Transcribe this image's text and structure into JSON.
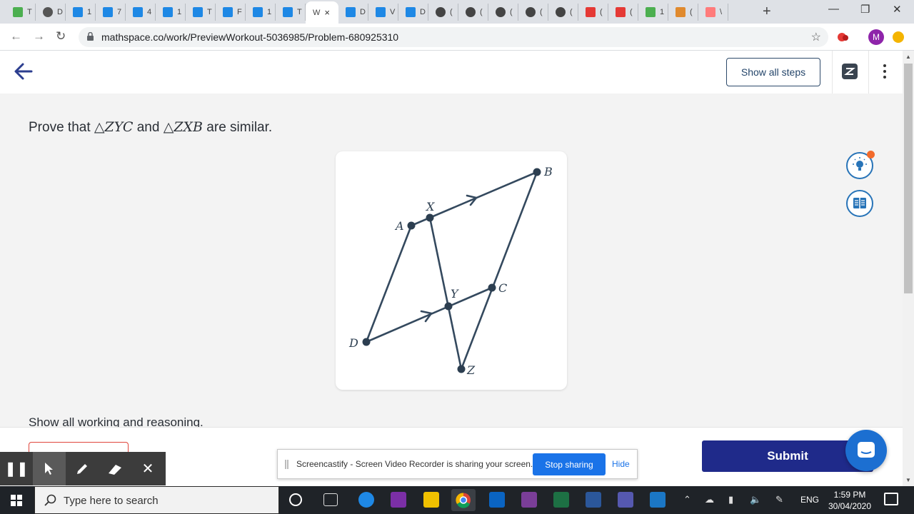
{
  "browser": {
    "tabs": [
      {
        "label": "T",
        "icon": "grass-icon"
      },
      {
        "label": "D",
        "icon": "gear-icon"
      },
      {
        "label": "1",
        "icon": "mathspace-icon"
      },
      {
        "label": "7",
        "icon": "mathspace-icon"
      },
      {
        "label": "4",
        "icon": "mathspace-icon"
      },
      {
        "label": "1",
        "icon": "mathspace-icon"
      },
      {
        "label": "T",
        "icon": "mathspace-icon"
      },
      {
        "label": "F",
        "icon": "mathspace-icon"
      },
      {
        "label": "1",
        "icon": "mathspace-icon"
      },
      {
        "label": "T",
        "icon": "mathspace-icon"
      },
      {
        "label": "W",
        "icon": "none",
        "active": true
      },
      {
        "label": "D",
        "icon": "mathspace-icon"
      },
      {
        "label": "V",
        "icon": "mathspace-icon"
      },
      {
        "label": "D",
        "icon": "mathspace-icon"
      },
      {
        "label": "(",
        "icon": "github-icon"
      },
      {
        "label": "(",
        "icon": "github-icon"
      },
      {
        "label": "(",
        "icon": "github-icon"
      },
      {
        "label": "(",
        "icon": "github-icon"
      },
      {
        "label": "(",
        "icon": "github-icon"
      },
      {
        "label": "(",
        "icon": "youtube-icon"
      },
      {
        "label": "(",
        "icon": "youtube-icon"
      },
      {
        "label": "1",
        "icon": "grass-icon"
      },
      {
        "label": "(",
        "icon": "hat-icon"
      },
      {
        "label": "\\",
        "icon": "screencastify-icon"
      }
    ],
    "url": "mathspace.co/work/PreviewWorkout-5036985/Problem-680925310",
    "profile_initial": "M",
    "accent": "#8e24aa"
  },
  "header": {
    "show_all_steps_label": "Show all steps"
  },
  "problem": {
    "prompt_prefix": "Prove that ",
    "triangle_1": "△ZYC",
    "prompt_mid": " and ",
    "triangle_2": "△ZXB",
    "prompt_suffix": " are similar.",
    "working_note": "Show all working and reasoning."
  },
  "figure": {
    "points": [
      "A",
      "B",
      "C",
      "D",
      "X",
      "Y",
      "Z"
    ],
    "line_color": "#34495e"
  },
  "footer": {
    "submit_label": "Submit",
    "submit_color": "#1f2a8a"
  },
  "screencastify": {
    "message": "Screencastify - Screen Video Recorder is sharing your screen.",
    "stop_label": "Stop sharing",
    "hide_label": "Hide"
  },
  "taskbar": {
    "search_placeholder": "Type here to search",
    "language": "ENG",
    "time": "1:59 PM",
    "date": "30/04/2020"
  }
}
